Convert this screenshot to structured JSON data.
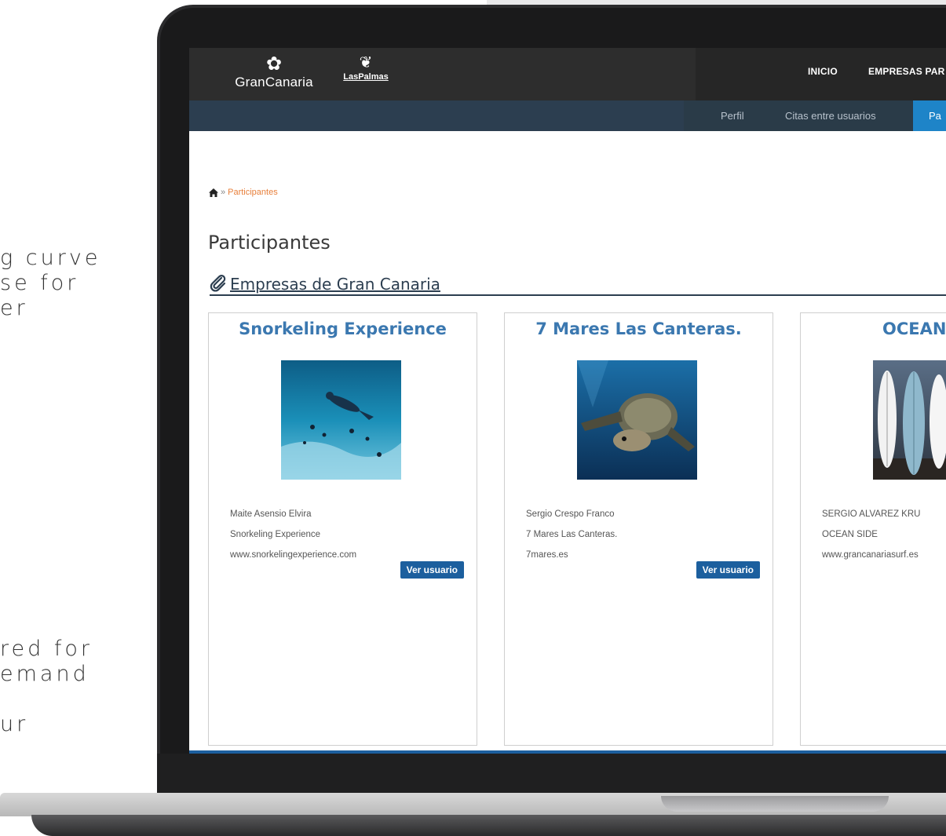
{
  "side_text": {
    "top_lines": "g curve\nse for\ner",
    "bottom_lines": "red for\nemand\n\nur"
  },
  "header": {
    "logo_primary": "GranCanaria",
    "logo_secondary": "LasPalmas",
    "nav": {
      "inicio": "INICIO",
      "empresas": "EMPRESAS PAR"
    }
  },
  "subnav": {
    "perfil": "Perfil",
    "citas": "Citas entre usuarios",
    "participantes": "Pa"
  },
  "breadcrumb": {
    "separator": "»",
    "current": "Participantes"
  },
  "page_title": "Participantes",
  "section_title": "Empresas de Gran Canaria",
  "cards": [
    {
      "title": "Snorkeling Experience",
      "contact": "Maite Asensio Elvira",
      "company": "Snorkeling Experience",
      "website": "www.snorkelingexperience.com",
      "button": "Ver usuario"
    },
    {
      "title": "7 Mares Las Canteras.",
      "contact": "Sergio Crespo Franco",
      "company": "7 Mares Las Canteras.",
      "website": "7mares.es",
      "button": "Ver usuario"
    },
    {
      "title": "OCEAN",
      "contact": "SERGIO ALVAREZ KRU",
      "company": "OCEAN SIDE",
      "website": "www.grancanariasurf.es"
    }
  ],
  "colors": {
    "accent": "#1e84c8",
    "breadcrumb": "#e8803c",
    "card_title": "#3b78b0",
    "button": "#1c5f9e"
  }
}
